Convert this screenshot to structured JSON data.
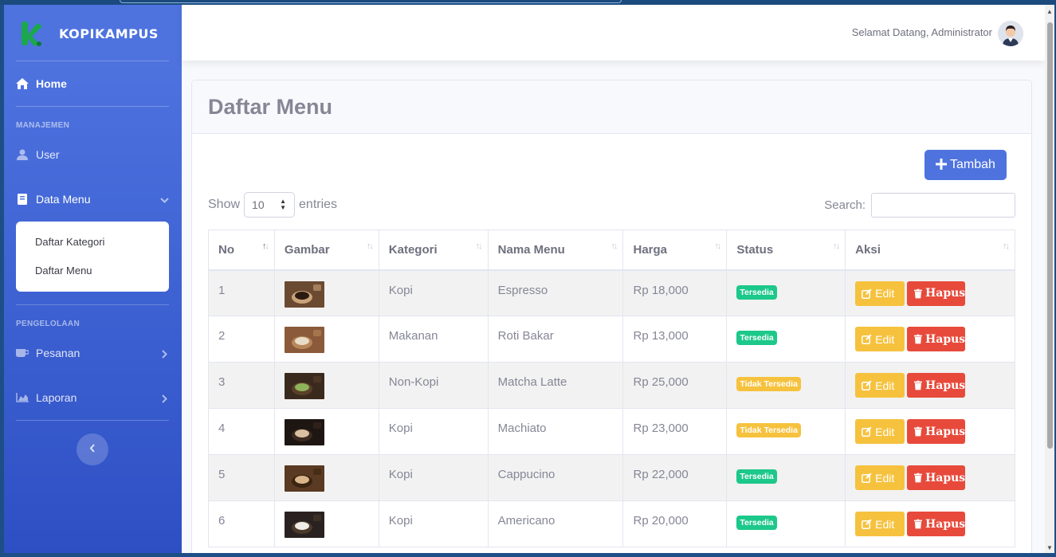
{
  "app": {
    "brand": "KOPIKAMPUS",
    "welcome": "Selamat Datang, Administrator"
  },
  "sidebar": {
    "home": "Home",
    "heading_manajemen": "MANAJEMEN",
    "user": "User",
    "data_menu": "Data Menu",
    "sub_kategori": "Daftar Kategori",
    "sub_menu": "Daftar Menu",
    "heading_pengelolaan": "PENGELOLAAN",
    "pesanan": "Pesanan",
    "laporan": "Laporan"
  },
  "page": {
    "title": "Daftar Menu",
    "add_button": "Tambah",
    "show_label": "Show",
    "entries_value": "10",
    "entries_label": "entries",
    "search_label": "Search:"
  },
  "table": {
    "headers": {
      "no": "No",
      "gambar": "Gambar",
      "kategori": "Kategori",
      "nama": "Nama Menu",
      "harga": "Harga",
      "status": "Status",
      "aksi": "Aksi"
    },
    "edit_label": "Edit",
    "delete_label": "Hapus",
    "rows": [
      {
        "no": "1",
        "kategori": "Kopi",
        "nama": "Espresso",
        "harga": "Rp 18,000",
        "status": "Tersedia",
        "available": true,
        "img": [
          "#6b4a32",
          "#2a1a10",
          "#c9a27a"
        ]
      },
      {
        "no": "2",
        "kategori": "Makanan",
        "nama": "Roti Bakar",
        "harga": "Rp 13,000",
        "status": "Tersedia",
        "available": true,
        "img": [
          "#8a5a3a",
          "#e8dcc8",
          "#b8875a"
        ]
      },
      {
        "no": "3",
        "kategori": "Non-Kopi",
        "nama": "Matcha Latte",
        "harga": "Rp 25,000",
        "status": "Tidak Tersedia",
        "available": false,
        "img": [
          "#3a2a1e",
          "#8fb35a",
          "#5a4028"
        ]
      },
      {
        "no": "4",
        "kategori": "Kopi",
        "nama": "Machiato",
        "harga": "Rp 23,000",
        "status": "Tidak Tersedia",
        "available": false,
        "img": [
          "#1e1612",
          "#d8c0a0",
          "#3a2a20"
        ]
      },
      {
        "no": "5",
        "kategori": "Kopi",
        "nama": "Cappucino",
        "harga": "Rp 22,000",
        "status": "Tersedia",
        "available": true,
        "img": [
          "#5a3a22",
          "#d9b58a",
          "#3a2412"
        ]
      },
      {
        "no": "6",
        "kategori": "Kopi",
        "nama": "Americano",
        "harga": "Rp 20,000",
        "status": "Tersedia",
        "available": true,
        "img": [
          "#2a2220",
          "#f0ece8",
          "#4a3a2a"
        ]
      }
    ]
  },
  "colors": {
    "primary": "#4e73df",
    "success": "#1cc88a",
    "warning": "#f6c23e",
    "danger": "#e74a3b"
  }
}
